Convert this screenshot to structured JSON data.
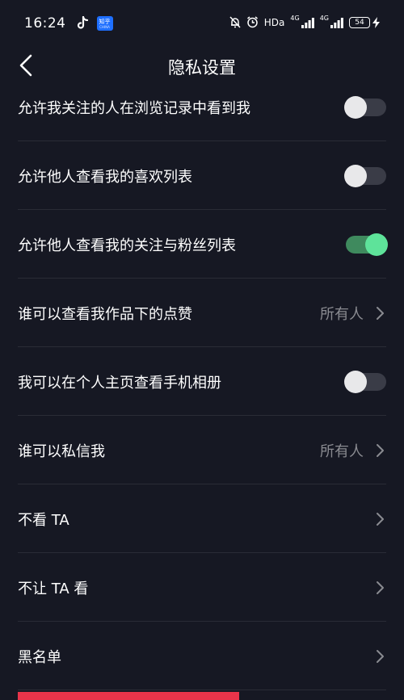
{
  "status_bar": {
    "time": "16:24",
    "app_badge_top": "知乎",
    "app_badge_bottom": "CHINA",
    "hd_label": "HDa",
    "net_label_1": "4G",
    "net_label_2": "4G",
    "battery": "54"
  },
  "header": {
    "title": "隐私设置"
  },
  "settings": [
    {
      "label": "允许我关注的人在浏览记录中看到我",
      "control": "toggle",
      "state": "off"
    },
    {
      "label": "允许他人查看我的喜欢列表",
      "control": "toggle",
      "state": "off"
    },
    {
      "label": "允许他人查看我的关注与粉丝列表",
      "control": "toggle",
      "state": "on"
    },
    {
      "label": "谁可以查看我作品下的点赞",
      "control": "value",
      "value": "所有人"
    },
    {
      "label": "我可以在个人主页查看手机相册",
      "control": "toggle",
      "state": "off"
    },
    {
      "label": "谁可以私信我",
      "control": "value",
      "value": "所有人"
    },
    {
      "label": "不看 TA",
      "control": "chevron"
    },
    {
      "label": "不让 TA 看",
      "control": "chevron"
    },
    {
      "label": "黑名单",
      "control": "chevron"
    }
  ],
  "colors": {
    "background": "#161823",
    "toggle_on": "#5ee39a",
    "accent_red": "#e8344a"
  },
  "icons": [
    "back-arrow-icon",
    "tiktok-icon",
    "mute-bell-icon",
    "alarm-icon",
    "signal-icon",
    "charging-icon",
    "chevron-right-icon"
  ]
}
